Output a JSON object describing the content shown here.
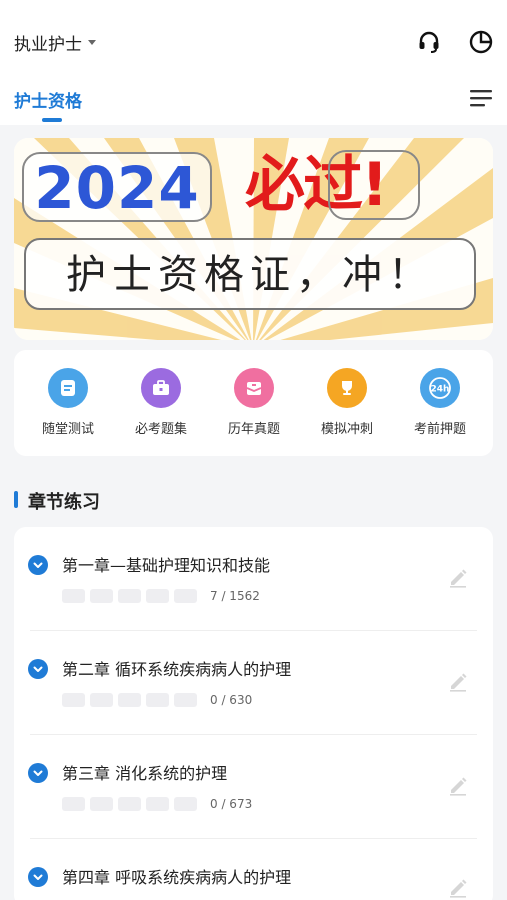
{
  "header": {
    "title": "执业护士",
    "tab_label": "护士资格",
    "icons": [
      "headset-icon",
      "pie-chart-icon",
      "menu-icon"
    ]
  },
  "banner": {
    "year": "2024",
    "pass_char1": "必",
    "pass_char2": "过",
    "exclaim": "!",
    "slogan": "护士资格证，冲！"
  },
  "quick_actions": [
    {
      "label": "随堂测试",
      "icon": "quiz-icon",
      "color": "#4aa4e8"
    },
    {
      "label": "必考题集",
      "icon": "briefcase-icon",
      "color": "#9b6be0"
    },
    {
      "label": "历年真题",
      "icon": "mail-icon",
      "color": "#f06fa0"
    },
    {
      "label": "模拟冲刺",
      "icon": "trophy-icon",
      "color": "#f5a623"
    },
    {
      "label": "考前押题",
      "icon": "24h-icon",
      "color": "#4aa4e8",
      "badge": "24h"
    }
  ],
  "section": {
    "title": "章节练习"
  },
  "chapters": [
    {
      "title": "第一章—基础护理知识和技能",
      "count": "7 / 1562"
    },
    {
      "title": "第二章  循环系统疾病病人的护理",
      "count": "0 / 630"
    },
    {
      "title": "第三章 消化系统的护理",
      "count": "0 / 673"
    },
    {
      "title": "第四章 呼吸系统疾病病人的护理",
      "count": ""
    }
  ],
  "colors": {
    "accent": "#1f7bd6",
    "pass_red": "#e21b1b",
    "year_blue": "#2d57d6"
  }
}
